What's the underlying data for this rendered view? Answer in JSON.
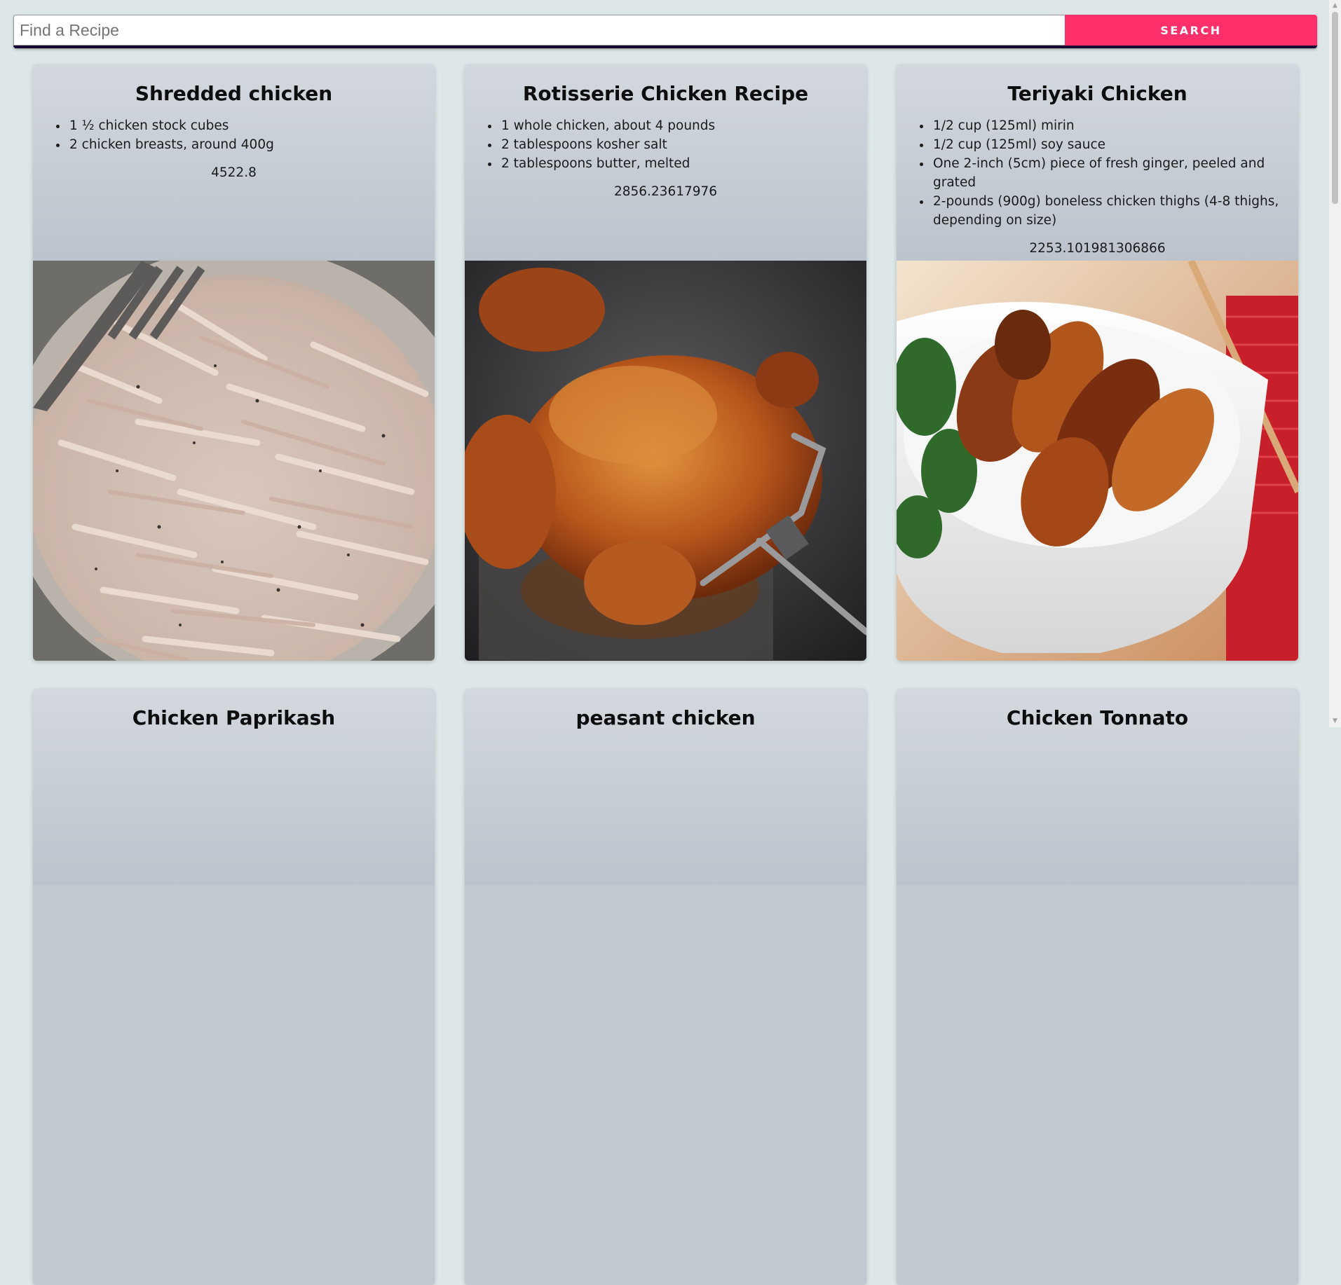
{
  "search": {
    "placeholder": "Find a Recipe",
    "value": "",
    "button_label": "SEARCH"
  },
  "recipes": [
    {
      "title": "Shredded chicken",
      "ingredients": [
        "1 ½ chicken stock cubes",
        "2 chicken breasts, around 400g"
      ],
      "calories": "4522.8",
      "image_alt": "plate of shredded chicken with a fork"
    },
    {
      "title": "Rotisserie Chicken Recipe",
      "ingredients": [
        "1 whole chicken, about 4 pounds",
        "2 tablespoons kosher salt",
        "2 tablespoons butter, melted"
      ],
      "calories": "2856.23617976",
      "image_alt": "whole roasted chicken on a rotisserie spit"
    },
    {
      "title": "Teriyaki Chicken",
      "ingredients": [
        "1/2 cup (125ml) mirin",
        "1/2 cup (125ml) soy sauce",
        "One 2-inch (5cm) piece of fresh ginger, peeled and grated",
        "2-pounds (900g) boneless chicken thighs (4-8 thighs, depending on size)"
      ],
      "calories": "2253.101981306866",
      "image_alt": "bowl of teriyaki chicken with greens"
    },
    {
      "title": "Chicken Paprikash",
      "ingredients": [],
      "calories": ""
    },
    {
      "title": "peasant chicken",
      "ingredients": [],
      "calories": ""
    },
    {
      "title": "Chicken Tonnato",
      "ingredients": [],
      "calories": ""
    }
  ],
  "colors": {
    "page_background": "#dde7e7",
    "search_button": "#ff2f6a",
    "card_background": "#c1c8d0"
  }
}
